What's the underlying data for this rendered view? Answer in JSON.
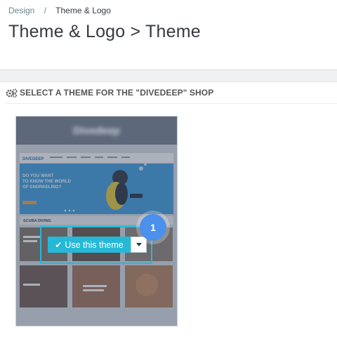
{
  "breadcrumb": {
    "parent": "Design",
    "separator": "/",
    "current": "Theme & Logo"
  },
  "page": {
    "title": "Theme & Logo > Theme"
  },
  "panel": {
    "heading": "SELECT A THEME FOR THE \"DIVEDEEP\" SHOP",
    "heading_icon": "cogs-icon"
  },
  "theme_card": {
    "name": "Divedeep",
    "preview": {
      "logo": "DIVEDEEP",
      "hero_text": [
        "DO YOU WANT",
        "TO KNOW THE WORLD",
        "OF SNORKELING?"
      ],
      "section_label": "SCUBA DIVING"
    },
    "use_button_label": "Use this theme",
    "use_button_icon": "check-icon",
    "dropdown_icon": "caret-down-icon"
  },
  "step_badge": {
    "number": "1"
  },
  "colors": {
    "accent": "#25b9d7",
    "badge": "#4a90ec",
    "card_overlay": "#5d687b"
  }
}
